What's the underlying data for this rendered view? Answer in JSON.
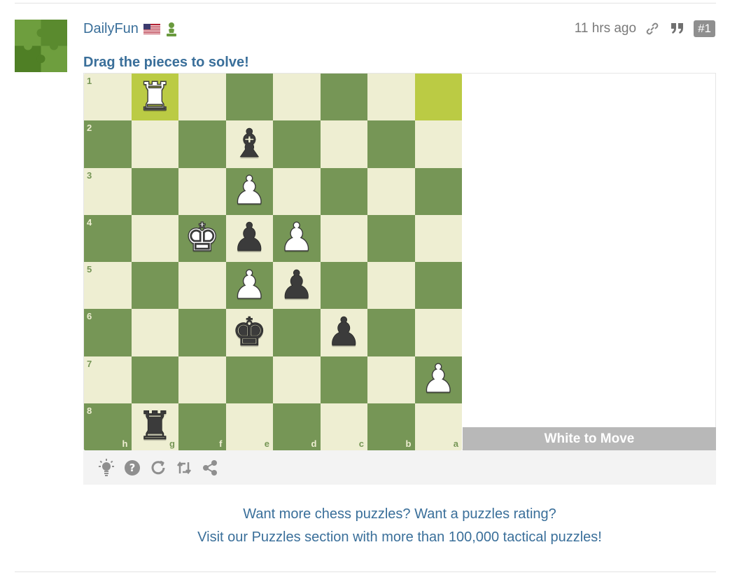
{
  "post": {
    "author": "DailyFun",
    "flag_icon": "us-flag-icon",
    "badge_icon": "pawn-icon",
    "time": "11 hrs ago",
    "post_number": "#1",
    "headline": "Drag the pieces to solve!"
  },
  "board": {
    "ranks": [
      "1",
      "2",
      "3",
      "4",
      "5",
      "6",
      "7",
      "8"
    ],
    "files": [
      "h",
      "g",
      "f",
      "e",
      "d",
      "c",
      "b",
      "a"
    ],
    "pieces": [
      {
        "square": "g1",
        "glyph": "♜",
        "color": "white"
      },
      {
        "square": "e2",
        "glyph": "♝",
        "color": "black"
      },
      {
        "square": "e3",
        "glyph": "♟",
        "color": "white"
      },
      {
        "square": "f4",
        "glyph": "♚",
        "color": "white"
      },
      {
        "square": "e4",
        "glyph": "♟",
        "color": "black"
      },
      {
        "square": "d4",
        "glyph": "♟",
        "color": "white"
      },
      {
        "square": "e5",
        "glyph": "♟",
        "color": "white"
      },
      {
        "square": "d5",
        "glyph": "♟",
        "color": "black"
      },
      {
        "square": "e6",
        "glyph": "♚",
        "color": "black"
      },
      {
        "square": "c6",
        "glyph": "♟",
        "color": "black"
      },
      {
        "square": "a7",
        "glyph": "♟",
        "color": "white"
      },
      {
        "square": "g8",
        "glyph": "♜",
        "color": "black"
      }
    ],
    "highlighted": [
      "g1",
      "a1"
    ],
    "colors": {
      "light": "#eeeed2",
      "dark": "#769656",
      "highlight": "#bbcb44"
    }
  },
  "status": "White to Move",
  "toolbar": {
    "icons": [
      "hint-icon",
      "help-icon",
      "reset-icon",
      "flip-icon",
      "share-icon"
    ]
  },
  "promo": {
    "line1": "Want more chess puzzles? Want a puzzles rating?",
    "line2": "Visit our Puzzles section with more than 100,000 tactical puzzles!"
  },
  "accent": "#3a6f9a"
}
